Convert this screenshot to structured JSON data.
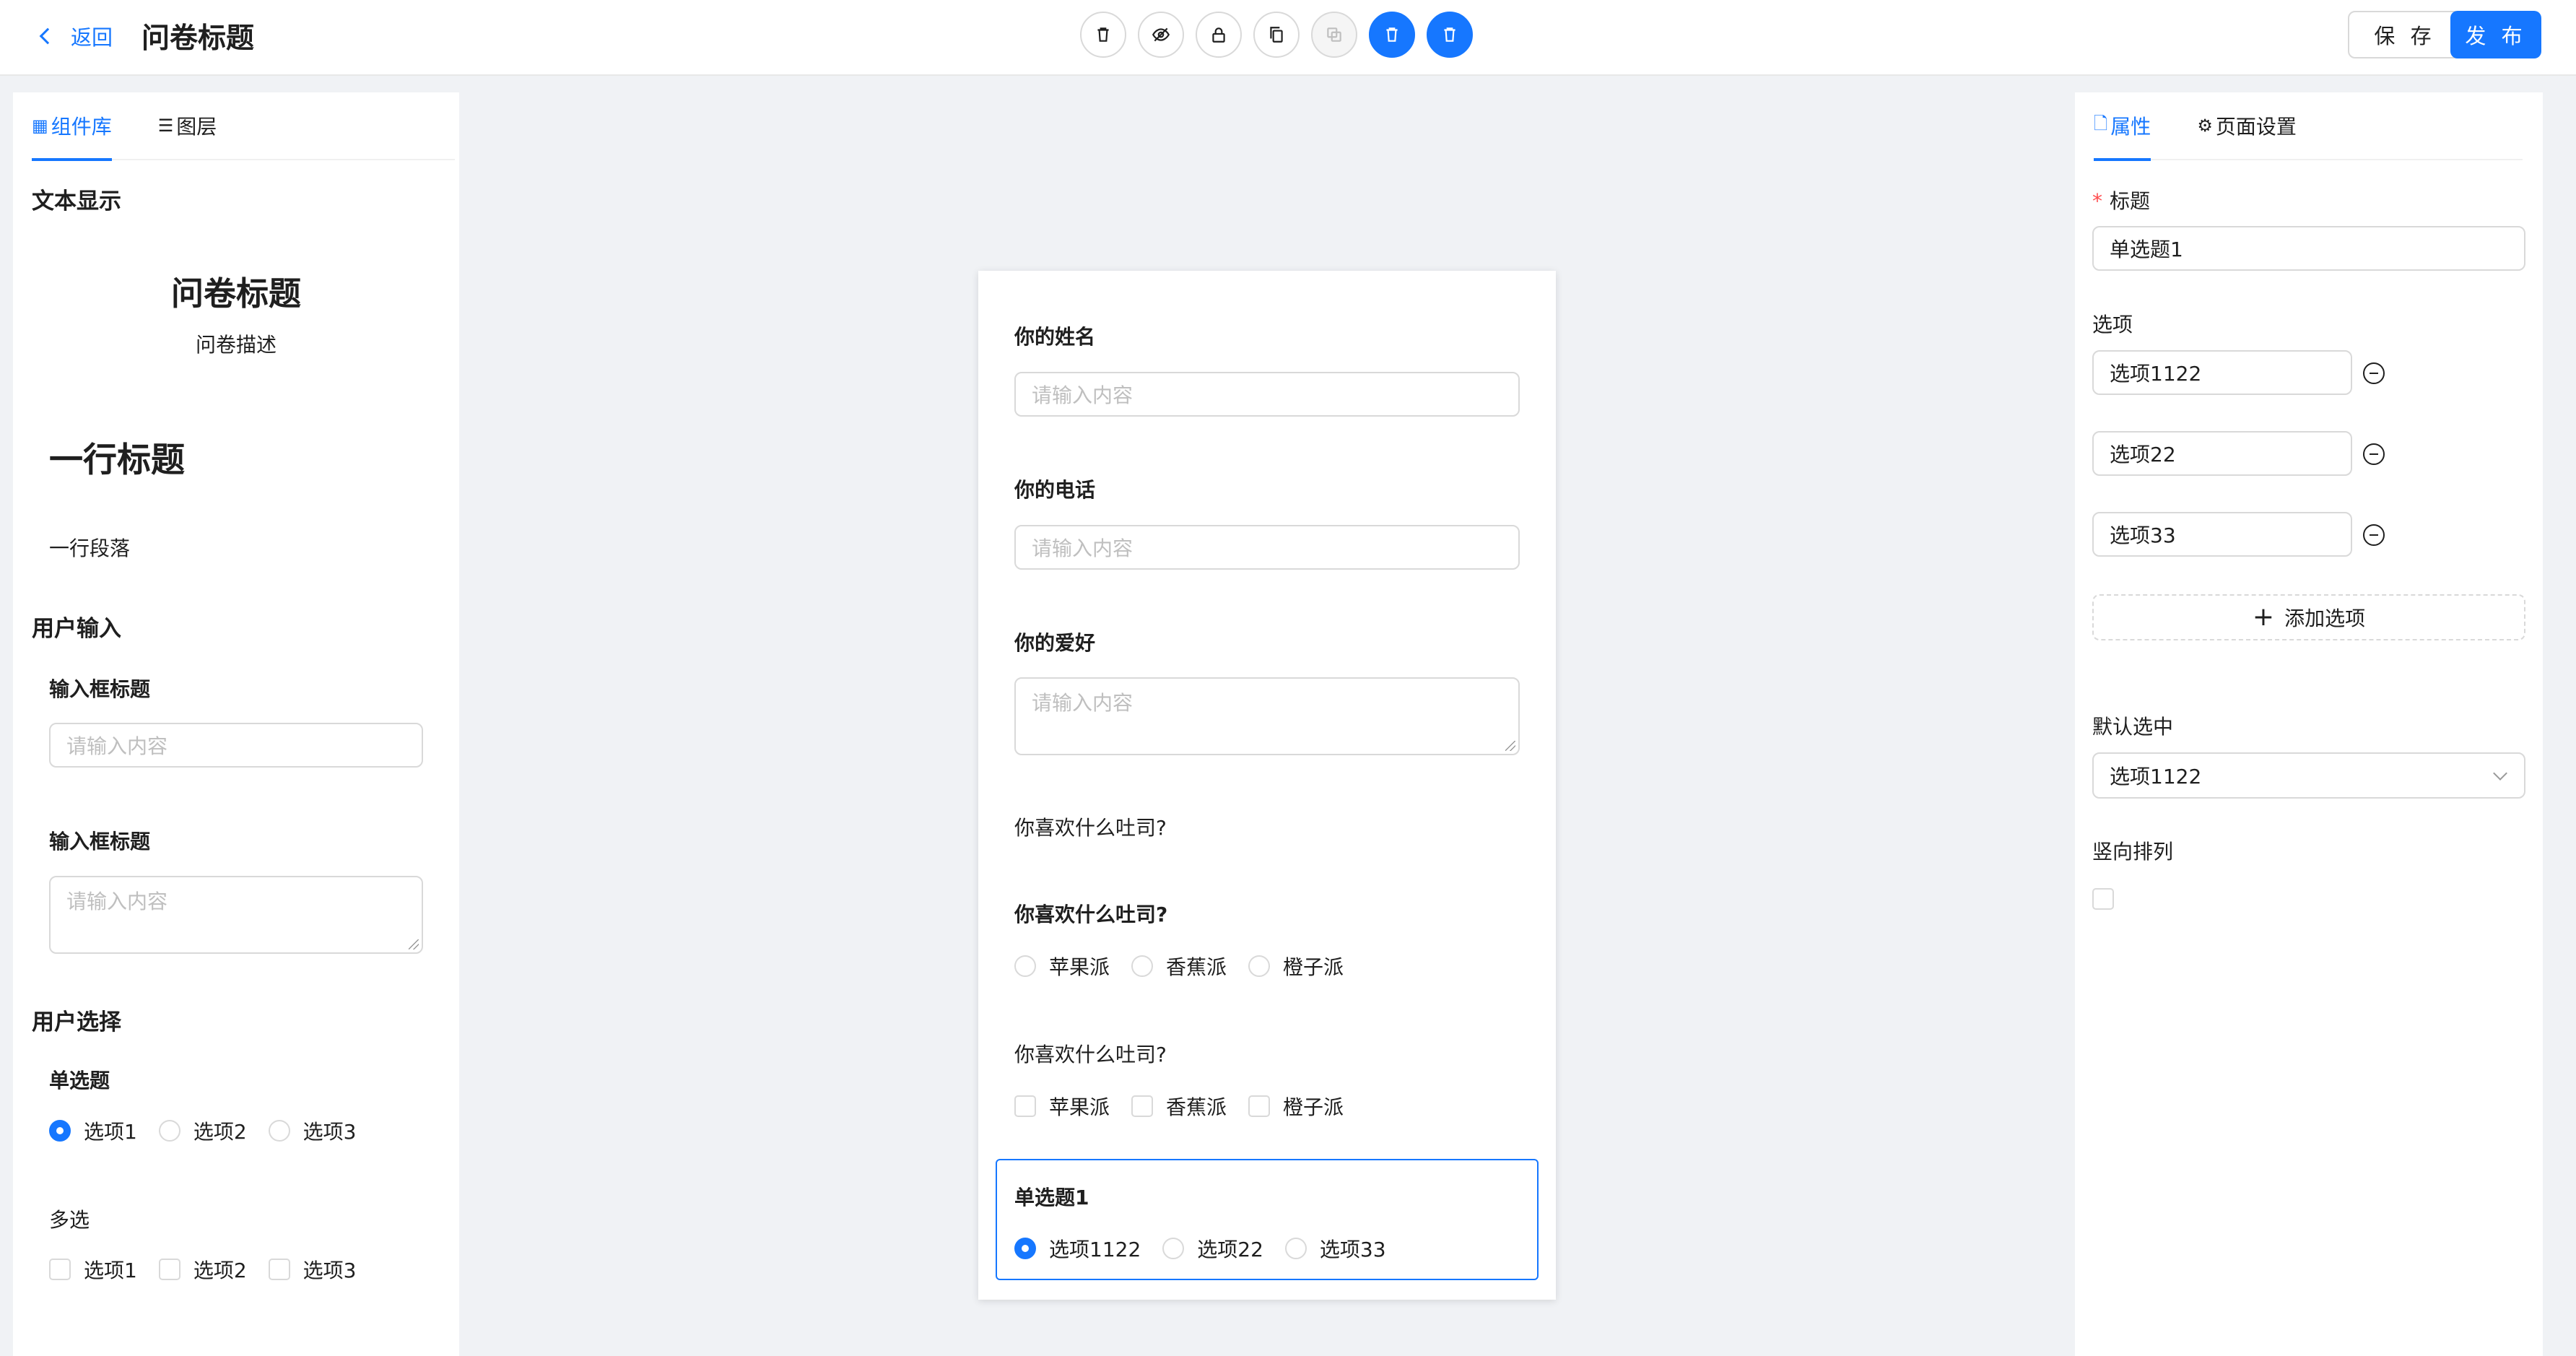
{
  "header": {
    "back_label": "返回",
    "title": "问卷标题",
    "toolbar_icons": [
      "delete-icon",
      "hide-icon",
      "lock-icon",
      "copy-icon",
      "paste-icon",
      "move-up-icon",
      "move-down-icon"
    ],
    "save_label": "保 存",
    "publish_label": "发 布"
  },
  "left_panel": {
    "tabs": [
      {
        "label": "组件库",
        "icon": "grid-icon",
        "active": true
      },
      {
        "label": "图层",
        "icon": "list-icon",
        "active": false
      }
    ],
    "text_section": {
      "title": "文本显示",
      "survey_title": "问卷标题",
      "survey_desc": "问卷描述",
      "heading": "一行标题",
      "paragraph": "一行段落"
    },
    "input_section": {
      "title": "用户输入",
      "input_label": "输入框标题",
      "input_placeholder": "请输入内容",
      "textarea_label": "输入框标题",
      "textarea_placeholder": "请输入内容"
    },
    "choice_section": {
      "title": "用户选择",
      "radio_title": "单选题",
      "radio_options": [
        "选项1",
        "选项2",
        "选项3"
      ],
      "checkbox_title": "多选",
      "checkbox_options": [
        "选项1",
        "选项2",
        "选项3"
      ]
    }
  },
  "canvas": {
    "name_label": "你的姓名",
    "name_placeholder": "请输入内容",
    "phone_label": "你的电话",
    "phone_placeholder": "请输入内容",
    "hobby_label": "你的爱好",
    "hobby_placeholder": "请输入内容",
    "paragraph": "你喜欢什么吐司?",
    "radio_q": {
      "title": "你喜欢什么吐司?",
      "options": [
        "苹果派",
        "香蕉派",
        "橙子派"
      ]
    },
    "check_q": {
      "title": "你喜欢什么吐司?",
      "options": [
        "苹果派",
        "香蕉派",
        "橙子派"
      ]
    },
    "selected_q": {
      "title": "单选题1",
      "options": [
        "选项1122",
        "选项22",
        "选项33"
      ],
      "selected": "选项1122"
    }
  },
  "right_panel": {
    "tabs": [
      {
        "label": "属性",
        "icon": "file-icon",
        "active": true
      },
      {
        "label": "页面设置",
        "icon": "settings-icon",
        "active": false
      }
    ],
    "title_label": "标题",
    "title_value": "单选题1",
    "options_label": "选项",
    "options": [
      "选项1122",
      "选项22",
      "选项33"
    ],
    "add_option_label": "添加选项",
    "default_label": "默认选中",
    "default_value": "选项1122",
    "vertical_label": "竖向排列",
    "vertical_checked": false
  },
  "colors": {
    "primary": "#1677ff",
    "background": "#f0f2f5",
    "border": "#d9d9d9",
    "required": "#ff4d4f"
  }
}
